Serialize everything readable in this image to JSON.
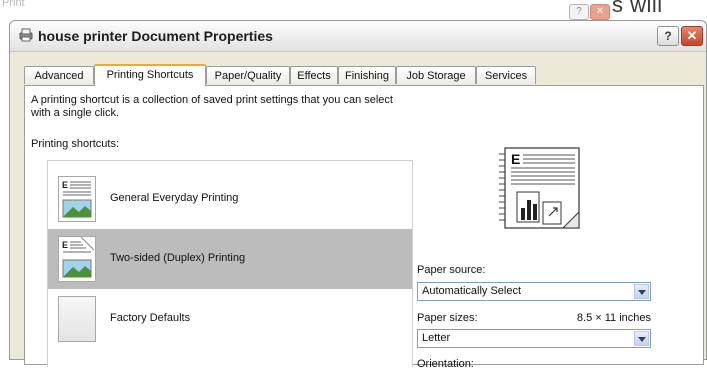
{
  "background_window": {
    "title": "Print",
    "help_glyph": "?",
    "close_glyph": "✕",
    "partial_text": "s will"
  },
  "dialog": {
    "title": "house printer Document Properties",
    "help_glyph": "?",
    "close_glyph": "✕",
    "title_icon": "printer-icon"
  },
  "tabs": [
    {
      "label": "Advanced"
    },
    {
      "label": "Printing Shortcuts"
    },
    {
      "label": "Paper/Quality"
    },
    {
      "label": "Effects"
    },
    {
      "label": "Finishing"
    },
    {
      "label": "Job Storage"
    },
    {
      "label": "Services"
    }
  ],
  "active_tab": "Printing Shortcuts",
  "content": {
    "description": "A printing shortcut is a collection of saved print settings that you can select with a single click.",
    "shortcuts_label": "Printing shortcuts:",
    "shortcuts": [
      {
        "label": "General Everyday Printing",
        "icon": "document-landscape-icon"
      },
      {
        "label": "Two-sided (Duplex) Printing",
        "icon": "duplex-document-icon",
        "selected": true
      },
      {
        "label": "Factory Defaults",
        "icon": "blank-document-icon"
      }
    ],
    "preview_icon": "page-preview-icon",
    "paper_source": {
      "label": "Paper source:",
      "value": "Automatically Select"
    },
    "paper_sizes": {
      "label": "Paper sizes:",
      "size_text": "8.5 × 11 inches",
      "value": "Letter"
    },
    "orientation": {
      "label": "Orientation:"
    }
  },
  "colors": {
    "selected_row": "#bcbcbc",
    "active_tab_accent": "#f0a830",
    "close_button": "#c5442a"
  }
}
